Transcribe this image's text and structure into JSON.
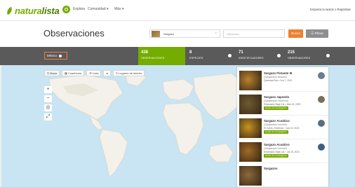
{
  "nav": {
    "logo_a": "natura",
    "logo_b": "lista",
    "links": [
      "Explora",
      "Comunidad ▾",
      "Más ▾"
    ],
    "login": "Empieza la sesión o Regístrate"
  },
  "page": {
    "title": "Observaciones"
  },
  "filters": {
    "species_value": "Sargazo",
    "place_placeholder": "Ubicación",
    "go_label": "Busca",
    "filters_label": "☰ Filtros"
  },
  "stats": {
    "place_pill": "México",
    "observations": {
      "value": "438",
      "label": "OBSERVACIONES"
    },
    "species": {
      "value": "8",
      "label": "ESPECIES"
    },
    "identifiers": {
      "value": "71",
      "label": "IDENTIFICADORES"
    },
    "observers": {
      "value": "215",
      "label": "OBSERVADORES"
    }
  },
  "map_tabs": [
    "⚲ Mapa",
    "▦ Cuadrícula",
    "☰ Lista",
    "●",
    "⚲ Lugares de interés"
  ],
  "map_controls": [
    "+",
    "−",
    "◎",
    "⤢"
  ],
  "results": [
    {
      "name": "Sargazo Flotante III",
      "sci": "(Sargassum fluitans)",
      "meta": "Quintana Roo  •  Jun 7, 2021",
      "badge": "",
      "photo": "#b9822f",
      "avatar": "#6b7c8e"
    },
    {
      "name": "Sargazo Japonés",
      "sci": "(Sargassum muticum)",
      "meta": "Ensenada, Baja Cal.  •  Mar 16, 2020",
      "badge": "Grado de investigación",
      "photo": "#6f5a33",
      "avatar": "#7a6d5a"
    },
    {
      "name": "Sargazo Acuático",
      "sci": "(Sargassum horneri)",
      "meta": "El Cardo, Ensenad.  •  Jan 21, 2022",
      "badge": "Grado de investigación",
      "photo": "#c8931f",
      "avatar": "#5a6f7d"
    },
    {
      "name": "Sargazo Acuático",
      "sci": "(Sargassum horneri)",
      "meta": "Ensenada, Baja Cal.  •  Jul 18, 2021",
      "badge": "Grado de investigación",
      "photo": "#a06b24",
      "avatar": "#3b5f86"
    },
    {
      "name": "Sargazos",
      "sci": "",
      "meta": "",
      "badge": "",
      "photo": "#8d6a3a",
      "avatar": "#888"
    }
  ],
  "colors": {
    "brand_green": "#74ac00",
    "accent_orange": "#f0802f",
    "stats_bar": "#5a5a5a",
    "ocean": "#c9e4f2"
  }
}
